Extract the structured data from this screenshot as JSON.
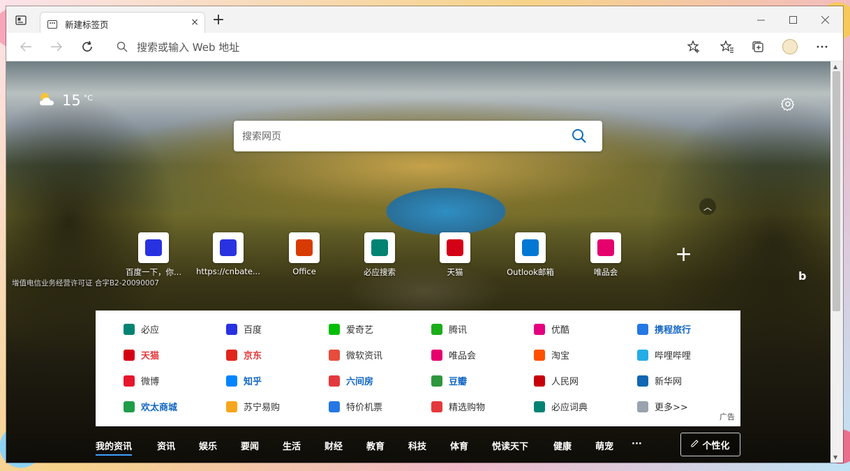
{
  "browser": {
    "tab": {
      "title": "新建标签页",
      "close": "×"
    },
    "new_tab": "+",
    "address_placeholder": "搜索或输入 Web 地址"
  },
  "page": {
    "weather": {
      "temperature": "15",
      "unit": "°C",
      "icon": "partly-cloudy-icon"
    },
    "search": {
      "placeholder": "搜索网页"
    },
    "collapse": "︿",
    "tiles": [
      {
        "label": "百度一下，你...",
        "icon": "baidu-icon",
        "color": "#2932e1"
      },
      {
        "label": "https://cnbate...",
        "icon": "baidu-icon",
        "color": "#2932e1"
      },
      {
        "label": "Office",
        "icon": "office-icon",
        "color": "#d83b01"
      },
      {
        "label": "必应搜索",
        "icon": "bing-icon",
        "color": "#008373"
      },
      {
        "label": "天猫",
        "icon": "tmall-icon",
        "color": "#d40016"
      },
      {
        "label": "Outlook邮箱",
        "icon": "outlook-icon",
        "color": "#0078d4"
      },
      {
        "label": "唯品会",
        "icon": "vip-icon",
        "color": "#e5006e"
      }
    ],
    "add_tile": "+",
    "license": "增值电信业务经营许可证 合字B2-20090007",
    "bing_corner": "b",
    "links": [
      [
        {
          "label": "必应",
          "icon": "bing-icon",
          "color": "#008373",
          "text_color": "#333",
          "bold": false
        },
        {
          "label": "百度",
          "icon": "baidu-icon",
          "color": "#2932e1",
          "text_color": "#333",
          "bold": false
        },
        {
          "label": "爱奇艺",
          "icon": "iqiyi-icon",
          "color": "#00be06",
          "text_color": "#333",
          "bold": false
        },
        {
          "label": "腾讯",
          "icon": "tencent-icon",
          "color": "#1aad19",
          "text_color": "#333",
          "bold": false
        },
        {
          "label": "优酷",
          "icon": "youku-icon",
          "color": "#e4007f",
          "text_color": "#333",
          "bold": false
        },
        {
          "label": "携程旅行",
          "icon": "ctrip-icon",
          "color": "#2577e3",
          "text_color": "#1266c4",
          "bold": true
        }
      ],
      [
        {
          "label": "天猫",
          "icon": "tmall-icon",
          "color": "#d40016",
          "text_color": "#e4393c",
          "bold": true
        },
        {
          "label": "京东",
          "icon": "jd-icon",
          "color": "#e1251b",
          "text_color": "#e4393c",
          "bold": true
        },
        {
          "label": "微软资讯",
          "icon": "msn-icon",
          "color": "#e74c3c",
          "text_color": "#333",
          "bold": false
        },
        {
          "label": "唯品会",
          "icon": "vip-icon",
          "color": "#e5006e",
          "text_color": "#333",
          "bold": false
        },
        {
          "label": "淘宝",
          "icon": "taobao-icon",
          "color": "#ff5000",
          "text_color": "#333",
          "bold": false
        },
        {
          "label": "哔哩哔哩",
          "icon": "bilibili-icon",
          "color": "#23ade5",
          "text_color": "#333",
          "bold": false
        }
      ],
      [
        {
          "label": "微博",
          "icon": "weibo-icon",
          "color": "#e6162d",
          "text_color": "#333",
          "bold": false
        },
        {
          "label": "知乎",
          "icon": "zhihu-icon",
          "color": "#0084ff",
          "text_color": "#1266c4",
          "bold": true
        },
        {
          "label": "六间房",
          "icon": "liujianfang-icon",
          "color": "#e4393c",
          "text_color": "#1266c4",
          "bold": true
        },
        {
          "label": "豆瓣",
          "icon": "douban-icon",
          "color": "#2e963d",
          "text_color": "#1266c4",
          "bold": true
        },
        {
          "label": "人民网",
          "icon": "people-icon",
          "color": "#c7000b",
          "text_color": "#333",
          "bold": false
        },
        {
          "label": "新华网",
          "icon": "xinhua-icon",
          "color": "#1167b1",
          "text_color": "#333",
          "bold": false
        }
      ],
      [
        {
          "label": "欢太商城",
          "icon": "heytap-icon",
          "color": "#1f9d4a",
          "text_color": "#1266c4",
          "bold": true
        },
        {
          "label": "苏宁易购",
          "icon": "suning-icon",
          "color": "#f7a51c",
          "text_color": "#333",
          "bold": false
        },
        {
          "label": "特价机票",
          "icon": "flight-icon",
          "color": "#2577e3",
          "text_color": "#333",
          "bold": false
        },
        {
          "label": "精选购物",
          "icon": "shopping-icon",
          "color": "#e4393c",
          "text_color": "#333",
          "bold": false
        },
        {
          "label": "必应词典",
          "icon": "bing-dict-icon",
          "color": "#008373",
          "text_color": "#333",
          "bold": false
        },
        {
          "label": "更多>>",
          "icon": "more-icon",
          "color": "#9aa3ad",
          "text_color": "#333",
          "bold": false
        }
      ]
    ],
    "ad_tag": "广告",
    "news_nav": [
      "我的资讯",
      "资讯",
      "娱乐",
      "要闻",
      "生活",
      "财经",
      "教育",
      "科技",
      "体育",
      "悦读天下",
      "健康",
      "萌宠"
    ],
    "more_dots": "···",
    "personalize": "个性化"
  }
}
